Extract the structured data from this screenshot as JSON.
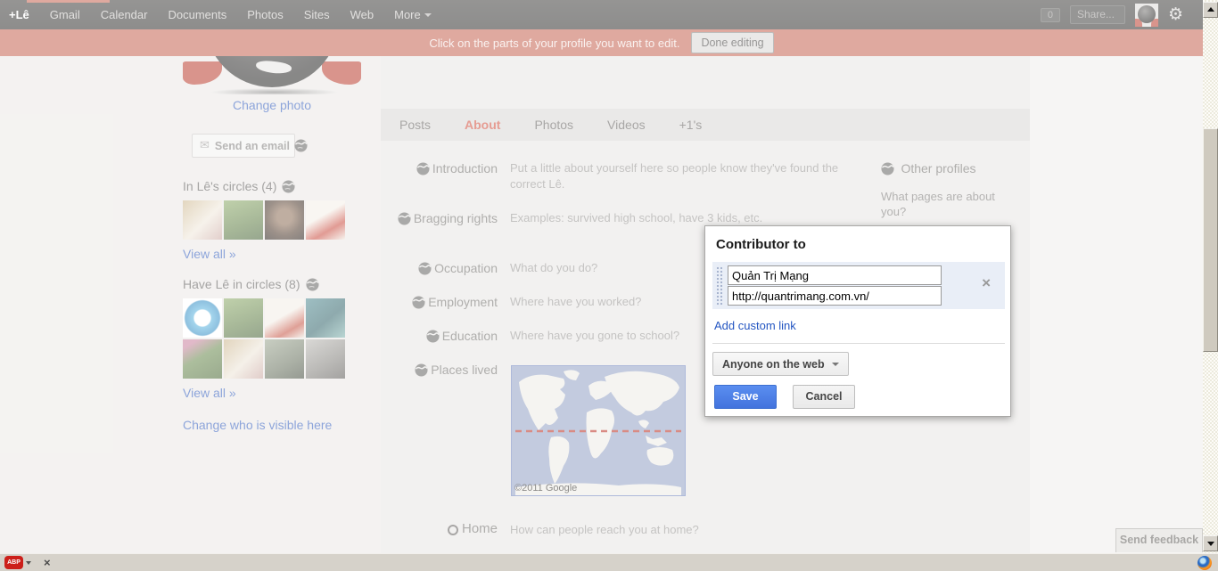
{
  "navbar": {
    "links": [
      "+Lê",
      "Gmail",
      "Calendar",
      "Documents",
      "Photos",
      "Sites",
      "Web"
    ],
    "more_label": "More",
    "notification_count": "0",
    "share_label": "Share...",
    "bar_color": "#333230"
  },
  "notice_bar": {
    "message": "Click on the parts of your profile you want to edit.",
    "done_button_label": "Done editing",
    "bar_color": "#c4604f"
  },
  "sidebar": {
    "change_photo_label": "Change photo",
    "send_email_label": "Send an email",
    "in_circles_heading": "In Lê's circles (4)",
    "view_all_label": "View all »",
    "have_in_circles_heading": "Have Lê in circles (8)",
    "view_all2_label": "View all »",
    "change_visible_label": "Change who is visible here",
    "avatars_in_circles": [
      {
        "name": "puppy-photo",
        "color": "linear-gradient(135deg,#cbb489,#efe7da 55%,#caa6a0)"
      },
      {
        "name": "woman-in-field",
        "color": "linear-gradient(160deg,#8aa964,#5d7c42 60%,#3f5c30)"
      },
      {
        "name": "man-portrait",
        "color": "radial-gradient(circle at 50% 42%,#8a6a52 25%,#4a3527 60%,#1f1713)"
      },
      {
        "name": "cartoon-red-chair",
        "color": "linear-gradient(150deg,#f4efe7 40%,#c8473a 70%,#efe9e0)"
      }
    ],
    "avatars_have_circles": [
      {
        "name": "blue-q-logo",
        "color": "radial-gradient(circle at 50% 50%,#ffffff 29%,#57b1dd 33%,#2f8cc4 62%,#ffffff 66%)"
      },
      {
        "name": "woman-in-field",
        "color": "linear-gradient(160deg,#8aa964,#5d7c42 60%,#3f5c30)"
      },
      {
        "name": "cartoon-lamp",
        "color": "linear-gradient(150deg,#f2ede5 45%,#c4503f 75%,#ece6dd)"
      },
      {
        "name": "father-and-baby",
        "color": "linear-gradient(140deg,#4c8890,#2f6268 55%,#7fb3ae)"
      },
      {
        "name": "woman-flower-field",
        "color": "linear-gradient(150deg,#c77f9b 15%,#66874a 45%,#45632f)"
      },
      {
        "name": "puppy-photo",
        "color": "linear-gradient(135deg,#c9b187,#ece4d6 55%,#c7a29c)"
      },
      {
        "name": "motorbike",
        "color": "linear-gradient(150deg,#9aa48e,#66705c 60%,#3c4436)"
      },
      {
        "name": "man-standing",
        "color": "linear-gradient(150deg,#b9b7b2,#807e79 60%,#565450)"
      }
    ]
  },
  "profile": {
    "tabs": [
      {
        "label": "Posts",
        "active": false
      },
      {
        "label": "About",
        "active": true
      },
      {
        "label": "Photos",
        "active": false
      },
      {
        "label": "Videos",
        "active": false
      },
      {
        "label": "+1's",
        "active": false
      }
    ],
    "sections": {
      "introduction": {
        "label": "Introduction",
        "value": "Put a little about yourself here so people know they've found the correct Lê."
      },
      "bragging": {
        "label": "Bragging rights",
        "value": "Examples: survived high school, have 3 kids, etc."
      },
      "occupation": {
        "label": "Occupation",
        "value": "What do you do?"
      },
      "employment": {
        "label": "Employment",
        "value": "Where have you worked?"
      },
      "education": {
        "label": "Education",
        "value": "Where have you gone to school?"
      },
      "places": {
        "label": "Places lived",
        "map_attribution": "©2011 Google"
      },
      "home": {
        "label": "Home",
        "value": "How can people reach you at home?"
      }
    },
    "other_profiles": {
      "label": "Other profiles",
      "hint": "What pages are about you?"
    }
  },
  "dialog": {
    "title": "Contributor to",
    "link_name_value": "Quản Trị Mạng",
    "link_url_value": "http://quantrimang.com.vn/",
    "remove_label": "×",
    "add_custom_link_label": "Add custom link",
    "visibility_value": "Anyone on the web",
    "save_label": "Save",
    "cancel_label": "Cancel",
    "accent_color": "#4a7fe0"
  },
  "feedback_button_label": "Send feedback",
  "browser": {
    "statusbar_abp_label": "ABP",
    "statusbar_close_label": "×"
  }
}
